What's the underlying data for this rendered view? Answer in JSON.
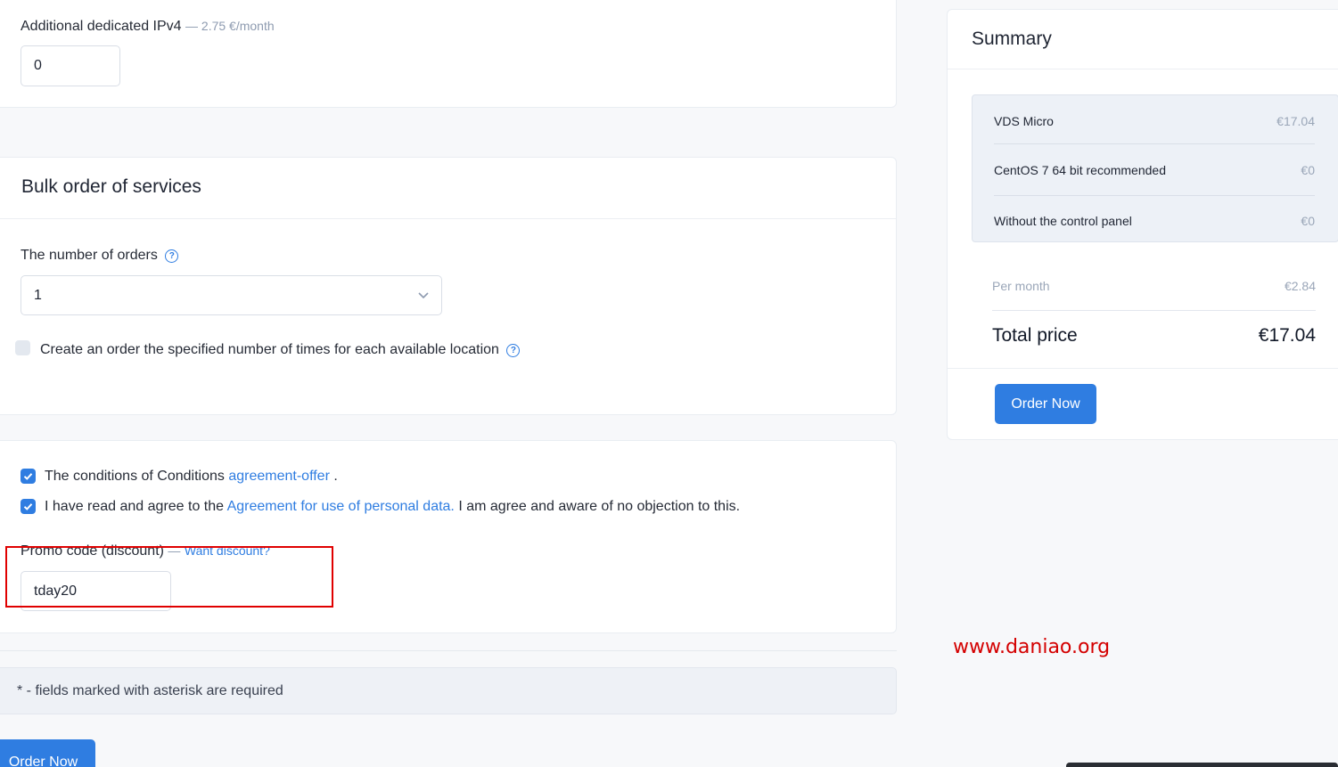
{
  "ipv4": {
    "label": "Additional dedicated IPv4",
    "price_note": "— 2.75 €/month",
    "value": "0"
  },
  "bulk": {
    "title": "Bulk order of services",
    "orders_label": "The number of orders",
    "orders_value": "1",
    "each_location_label": "Create an order the specified number of times for each available location"
  },
  "agreements": {
    "conditions_prefix": "The conditions of Conditions",
    "conditions_link": "agreement-offer",
    "conditions_suffix": ".",
    "personal_prefix": "I have read and agree to the",
    "personal_link": "Agreement for use of personal data.",
    "personal_suffix": "I am agree and aware of no objection to this."
  },
  "promo": {
    "label": "Promo code (discount)",
    "sep": "—",
    "want_link": "Want discount?",
    "value": "tday20"
  },
  "required_note": "* - fields marked with asterisk are required",
  "order_button_bottom": "Order Now",
  "summary": {
    "title": "Summary",
    "items": [
      {
        "name": "VDS Micro",
        "price": "€17.04"
      },
      {
        "name": "CentOS 7 64 bit recommended",
        "price": "€0"
      },
      {
        "name": "Without the control panel",
        "price": "€0"
      }
    ],
    "per_month_label": "Per month",
    "per_month_value": "€2.84",
    "total_label": "Total price",
    "total_value": "€17.04",
    "order_button": "Order Now"
  },
  "watermark": "www.daniao.org",
  "colors": {
    "accent": "#2f7de1",
    "highlight_box": "#e00000",
    "watermark": "#d40000"
  },
  "icons": [
    "help-circle-icon",
    "chevron-down-icon",
    "checkmark-icon"
  ]
}
